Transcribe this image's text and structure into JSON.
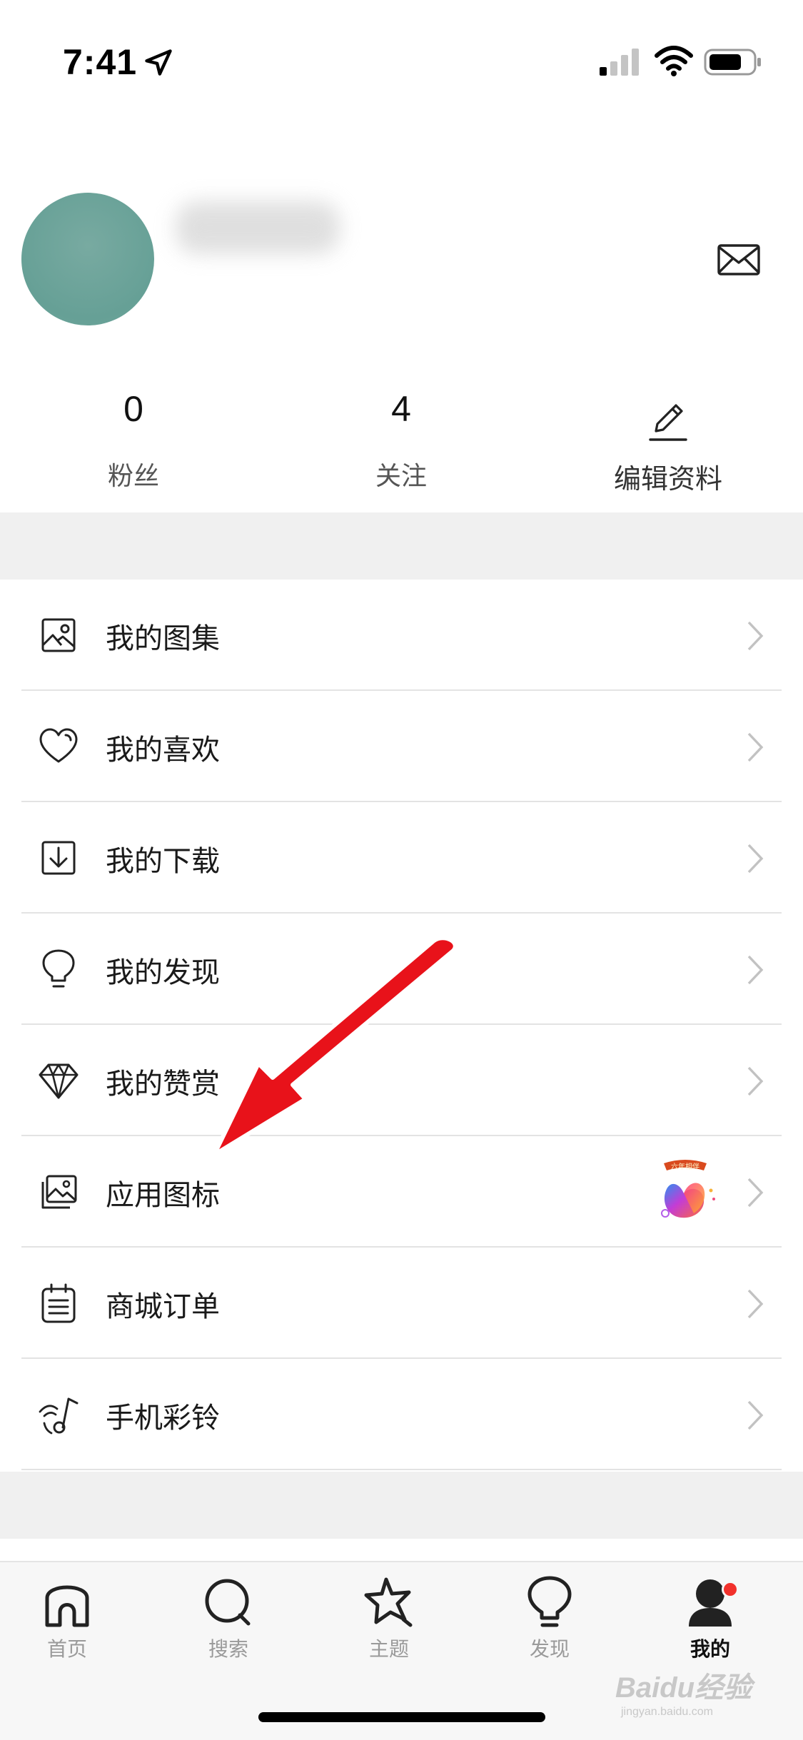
{
  "status_bar": {
    "time": "7:41",
    "icons": [
      "location-arrow-icon",
      "cellular-signal-icon",
      "wifi-icon",
      "battery-icon"
    ]
  },
  "profile": {
    "avatar_color": "#6aa398",
    "stats": [
      {
        "value": "0",
        "label": "粉丝"
      },
      {
        "value": "4",
        "label": "关注"
      }
    ],
    "edit_label": "编辑资料",
    "icons": [
      "envelope-icon",
      "pencil-icon"
    ]
  },
  "menu": {
    "items": [
      {
        "label": "我的图集",
        "icon": "album-icon"
      },
      {
        "label": "我的喜欢",
        "icon": "heart-icon"
      },
      {
        "label": "我的下载",
        "icon": "download-icon"
      },
      {
        "label": "我的发现",
        "icon": "lightbulb-icon"
      },
      {
        "label": "我的赞赏",
        "icon": "diamond-icon"
      },
      {
        "label": "应用图标",
        "icon": "image-icon",
        "badge_text": "六年相伴"
      },
      {
        "label": "商城订单",
        "icon": "order-list-icon"
      },
      {
        "label": "手机彩铃",
        "icon": "ringtone-icon"
      }
    ]
  },
  "tab_bar": {
    "tabs": [
      {
        "label": "首页",
        "icon": "home-icon",
        "active": false
      },
      {
        "label": "搜索",
        "icon": "search-icon",
        "active": false
      },
      {
        "label": "主题",
        "icon": "star-icon",
        "active": false
      },
      {
        "label": "发现",
        "icon": "lightbulb-icon",
        "active": false
      },
      {
        "label": "我的",
        "icon": "user-icon",
        "active": true
      }
    ]
  },
  "watermark": {
    "text": "Baidu经验",
    "sub": "jingyan.baidu.com"
  },
  "colors": {
    "accent_red": "#f2312c",
    "annotation_arrow": "#e8121a",
    "separator": "#f0f0f0"
  }
}
